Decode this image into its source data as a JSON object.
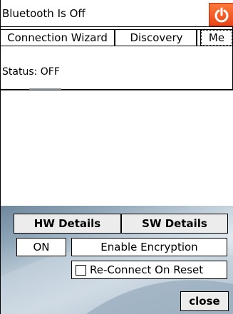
{
  "title": "Bluetooth Is Off",
  "power_icon": "power-icon",
  "tabs": [
    {
      "label": "Connection Wizard",
      "selected": false
    },
    {
      "label": "Discovery",
      "selected": false
    },
    {
      "label": "Me",
      "selected": true
    }
  ],
  "status": {
    "text": "Status: OFF"
  },
  "buttons": {
    "hw_details": "HW Details",
    "sw_details": "SW Details",
    "on": "ON",
    "enable_encryption": "Enable Encryption",
    "close": "close"
  },
  "reconnect": {
    "label": "Re-Connect On Reset",
    "checked": false
  },
  "colors": {
    "power_button": "#e8451a",
    "panel": "#ececec",
    "background_blue": "#8fa6b8"
  }
}
